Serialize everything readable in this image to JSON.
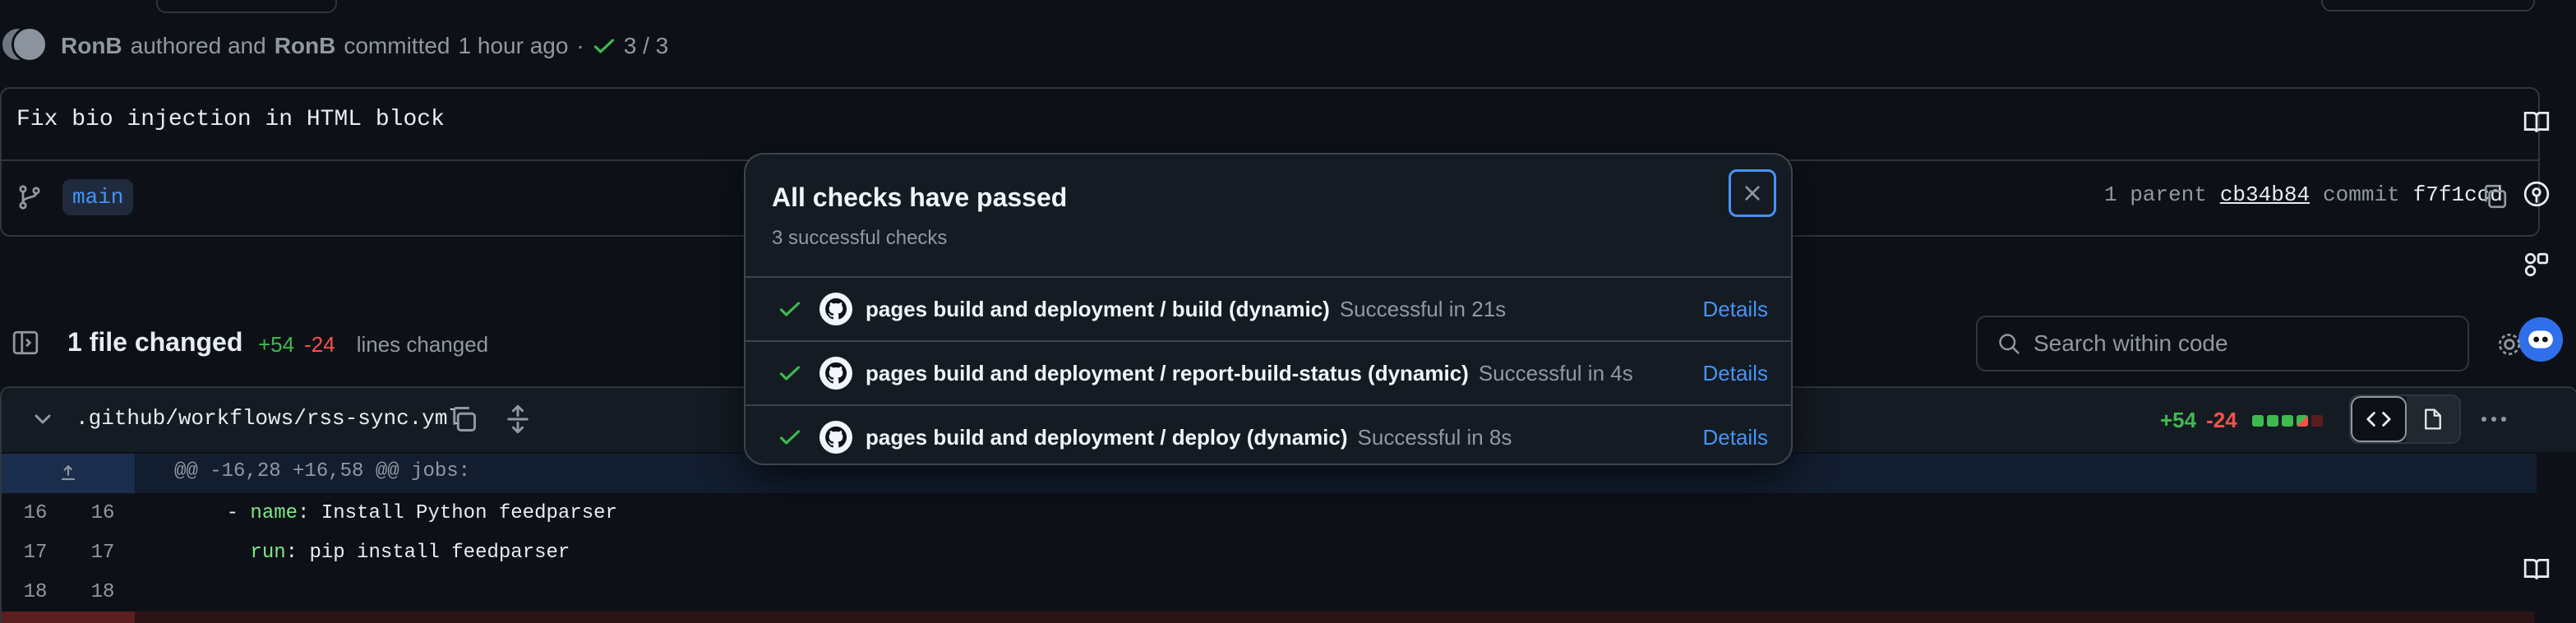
{
  "commit": {
    "author": "RonB",
    "authored_text": "authored and",
    "committer": "RonB",
    "committed_text": "committed",
    "time": "1 hour ago",
    "separator": "·",
    "checks_count": "3 / 3",
    "message": "Fix bio injection in HTML block",
    "branch": "main",
    "parent_label": "1 parent",
    "parent_hash": "cb34b84",
    "commit_label": "commit",
    "commit_hash": "f7f1ccd"
  },
  "files_bar": {
    "files_changed": "1 file changed",
    "additions": "+54",
    "deletions": "-24",
    "lines_changed_label": "lines changed",
    "search_placeholder": "Search within code"
  },
  "file": {
    "path": ".github/workflows/rss-sync.yml",
    "additions": "+54",
    "deletions": "-24",
    "hunk_header": "@@ -16,28 +16,58 @@ jobs:",
    "lines": [
      {
        "old": "16",
        "new": "16",
        "prefix": "    - ",
        "key": "name",
        "rest": ": Install Python feedparser"
      },
      {
        "old": "17",
        "new": "17",
        "prefix": "      ",
        "key": "run",
        "rest": ": pip install feedparser"
      },
      {
        "old": "18",
        "new": "18",
        "prefix": "",
        "key": "",
        "rest": ""
      }
    ]
  },
  "modal": {
    "title": "All checks have passed",
    "subtitle": "3 successful checks",
    "checks": [
      {
        "name": "pages build and deployment / build (dynamic)",
        "status": "Successful in 21s",
        "details": "Details"
      },
      {
        "name": "pages build and deployment / report-build-status (dynamic)",
        "status": "Successful in 4s",
        "details": "Details"
      },
      {
        "name": "pages build and deployment / deploy (dynamic)",
        "status": "Successful in 8s",
        "details": "Details"
      }
    ]
  },
  "colors": {
    "success": "#3fb950",
    "danger": "#f85149",
    "accent": "#4493f8",
    "background": "#0d1117"
  }
}
